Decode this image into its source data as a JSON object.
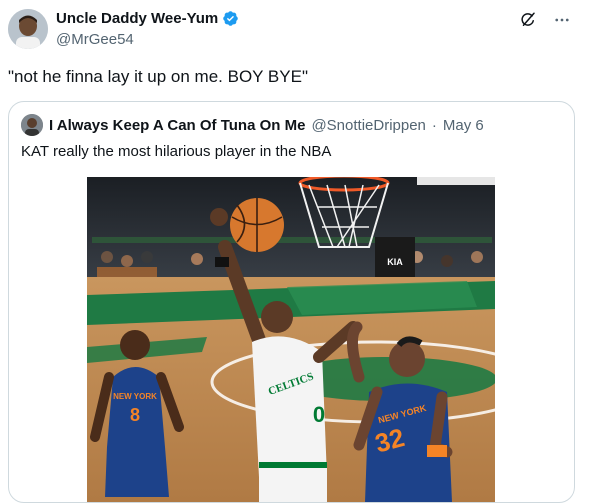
{
  "tweet": {
    "display_name": "Uncle Daddy Wee-Yum",
    "handle": "@MrGee54",
    "text": "\"not he finna lay it up on me. BOY BYE\"",
    "icons": [
      "verified-badge-icon",
      "grok-icon",
      "more-icon"
    ]
  },
  "quote": {
    "display_name": "I Always Keep A Can Of Tuna On Me",
    "handle": "@SnottieDrippen",
    "separator": "·",
    "date": "May 6",
    "text": "KAT really the most hilarious player in the NBA",
    "photo": {
      "jersey_left": "8",
      "jersey_left_team": "NEW YORK",
      "jersey_center_team": "CELTICS",
      "jersey_center": "0",
      "jersey_right_team": "NEW YORK",
      "jersey_right": "32",
      "court_sponsor": "KIA",
      "accent_colors": {
        "knicks_blue": "#1d428a",
        "knicks_orange": "#f58426",
        "celtics_green": "#007a33"
      }
    }
  }
}
